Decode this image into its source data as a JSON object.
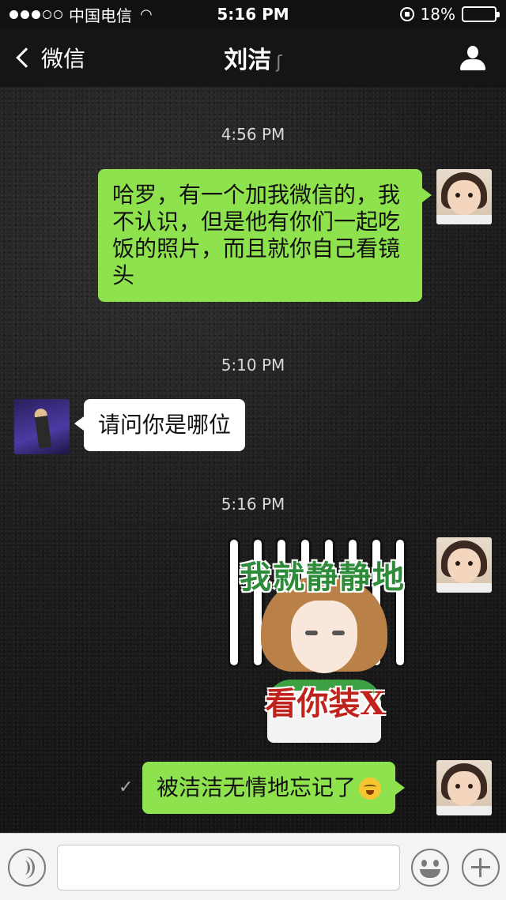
{
  "status_bar": {
    "carrier": "中国电信",
    "time": "5:16 PM",
    "battery": "18%",
    "battery_level": 0.18,
    "battery_color": "#e02020"
  },
  "nav": {
    "back_label": "微信",
    "title": "刘洁",
    "title_icon": "ear-icon",
    "right_icon": "user-profile-icon"
  },
  "messages": [
    {
      "type": "time",
      "text": "4:56 PM"
    },
    {
      "type": "text",
      "side": "right",
      "text": "哈罗，有一个加我微信的，我不认识，但是他有你们一起吃饭的照片，而且就你自己看镜头"
    },
    {
      "type": "time",
      "text": "5:10 PM"
    },
    {
      "type": "text",
      "side": "left",
      "text": "请问你是哪位"
    },
    {
      "type": "time",
      "text": "5:16 PM"
    },
    {
      "type": "sticker",
      "side": "right",
      "top_text": "我就静静地",
      "bottom_text": "看你装X"
    },
    {
      "type": "text",
      "side": "right",
      "text": "被洁洁无情地忘记了",
      "emoji": "crying-laughing-emoji",
      "status_icon": "checkmark-icon"
    }
  ],
  "input_bar": {
    "value": "",
    "placeholder": "",
    "voice_icon": "voice-icon",
    "emoji_icon": "emoji-icon",
    "plus_icon": "plus-icon"
  },
  "colors": {
    "bubble_sent": "#8ee24e",
    "bubble_received": "#ffffff",
    "bar_bg": "#111111"
  }
}
